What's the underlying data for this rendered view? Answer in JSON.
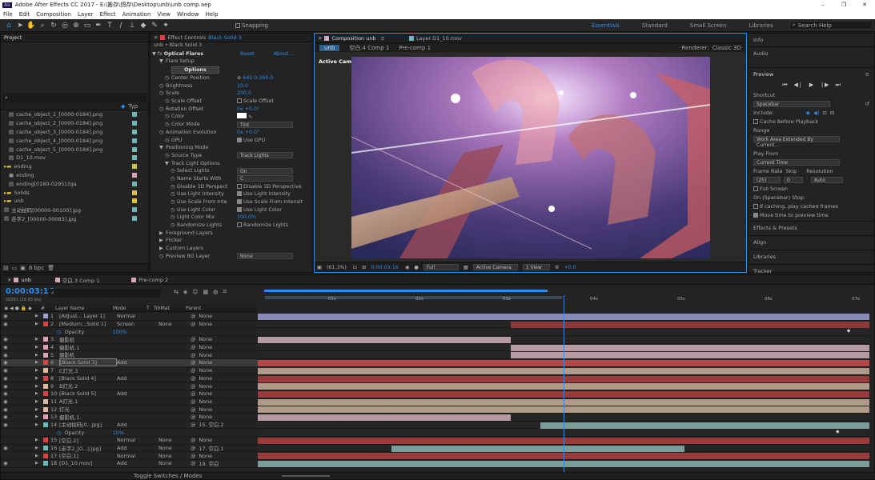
{
  "window": {
    "app_icon": "Ae",
    "title": "Adobe After Effects CC 2017 - E:\\搬存\\鸽存\\Desktop\\unb\\unb comp.aep",
    "controls": [
      "–",
      "❐",
      "✕"
    ]
  },
  "menu": [
    "File",
    "Edit",
    "Composition",
    "Layer",
    "Effect",
    "Animation",
    "View",
    "Window",
    "Help"
  ],
  "toolbar": {
    "snapping": "Snapping",
    "workspaces": [
      "Essentials",
      "Standard",
      "Small Screen",
      "Libraries"
    ],
    "search_placeholder": "Search Help"
  },
  "project": {
    "tab": "Project",
    "footer": "8 bpc",
    "col_type": "Typ",
    "items": [
      {
        "label": "cache_object_1_[0000-0184].png",
        "indent": 1,
        "kind": "file",
        "color": "#6fb8b8"
      },
      {
        "label": "cache_object_2_[0000-0184].png",
        "indent": 1,
        "kind": "file",
        "color": "#6fb8b8"
      },
      {
        "label": "cache_object_3_[0000-0184].png",
        "indent": 1,
        "kind": "file",
        "color": "#6fb8b8"
      },
      {
        "label": "cache_object_4_[0000-0184].png",
        "indent": 1,
        "kind": "file",
        "color": "#6fb8b8"
      },
      {
        "label": "cache_object_5_[0000-0184].png",
        "indent": 1,
        "kind": "file",
        "color": "#6fb8b8"
      },
      {
        "label": "D1_10.mov",
        "indent": 1,
        "kind": "file",
        "color": "#6fb8b8"
      },
      {
        "label": "ending",
        "indent": 0,
        "kind": "folder",
        "color": "#d8c040"
      },
      {
        "label": "ending",
        "indent": 1,
        "kind": "comp",
        "color": "#d8a8b8"
      },
      {
        "label": "ending[0180-0295].tga",
        "indent": 1,
        "kind": "file",
        "color": "#6fb8b8"
      },
      {
        "label": "Solids",
        "indent": 0,
        "kind": "folder",
        "color": "#d8c040"
      },
      {
        "label": "unb",
        "indent": 0,
        "kind": "folder",
        "color": "#d8c040"
      },
      {
        "label": "主动拍码[00000-00100].jpg",
        "indent": 0,
        "kind": "file",
        "color": "#6fb8b8"
      },
      {
        "label": "走字2_[00000-00083].jpg",
        "indent": 0,
        "kind": "file",
        "color": "#6fb8b8"
      }
    ]
  },
  "effect_controls": {
    "tab_prefix": "Effect Controls",
    "tab_layer": "Black Solid 3",
    "breadcrumb": "unb • Black Solid 3",
    "effect_name": "Optical Flares",
    "reset": "Reset",
    "about": "About...",
    "options_button": "Options",
    "props": [
      {
        "l": "Flare Setup",
        "t": "group",
        "i": 1
      },
      {
        "l": "Center Position",
        "v": "640.0,360.0",
        "t": "pos",
        "i": 2
      },
      {
        "l": "Brightness",
        "v": "10.0",
        "t": "val",
        "i": 1
      },
      {
        "l": "Scale",
        "v": "200.0",
        "t": "val",
        "i": 1
      },
      {
        "l": "Scale Offset",
        "c": "Scale Offset",
        "t": "cb",
        "i": 2
      },
      {
        "l": "Rotation Offset",
        "v": "0x +0.0°",
        "t": "val",
        "i": 1
      },
      {
        "l": "Color",
        "t": "color",
        "i": 2
      },
      {
        "l": "Color Mode",
        "s": "Tint",
        "t": "sel",
        "i": 2
      },
      {
        "l": "Animation Evolution",
        "v": "0x +0.0°",
        "t": "val",
        "i": 1
      },
      {
        "l": "GPU",
        "c": "Use GPU",
        "t": "cb",
        "i": 2,
        "on": true
      },
      {
        "l": "Positioning Mode",
        "t": "group",
        "i": 1
      },
      {
        "l": "Source Type",
        "s": "Track Lights",
        "t": "sel",
        "i": 2
      },
      {
        "l": "Track Light Options",
        "t": "group",
        "i": 2
      },
      {
        "l": "Select Lights",
        "s": "On",
        "t": "sel",
        "i": 3
      },
      {
        "l": "Name Starts With",
        "s": "C",
        "t": "sel",
        "i": 3
      },
      {
        "l": "Disable 3D Perspect",
        "c": "Disable 3D Perspective",
        "t": "cb",
        "i": 3
      },
      {
        "l": "Use Light Intensity",
        "c": "Use Light Intensity",
        "t": "cb",
        "i": 3,
        "on": true
      },
      {
        "l": "Use Scale From Inte",
        "c": "Use Scale From Intensit",
        "t": "cb",
        "i": 3,
        "on": true
      },
      {
        "l": "Use Light Color",
        "c": "Use Light Color",
        "t": "cb",
        "i": 3,
        "on": true
      },
      {
        "l": "Light Color Mix",
        "v": "100.0%",
        "t": "val",
        "i": 3
      },
      {
        "l": "Randomize Lights",
        "c": "Randomize Lights",
        "t": "cb",
        "i": 3
      },
      {
        "l": "Foreground Layers",
        "t": "group",
        "i": 1
      },
      {
        "l": "Flicker",
        "t": "group",
        "i": 1
      },
      {
        "l": "Custom Layers",
        "t": "group",
        "i": 1
      },
      {
        "l": "Preview BG Layer",
        "s": "None",
        "t": "sel",
        "i": 1
      }
    ]
  },
  "viewer": {
    "tab_comp": "Composition unb",
    "tab_layer": "Layer D1_10.mov",
    "flow": [
      "unb",
      "空白.4 Comp 1",
      "Pre-comp 1"
    ],
    "renderer_label": "Renderer:",
    "renderer": "Classic 3D",
    "active_camera": "Active Camera",
    "footer": {
      "zoom": "(61.3%)",
      "time": "0:00:03:16",
      "resolution": "Full",
      "camera": "Active Camera",
      "views": "1 View",
      "exposure": "+0.0"
    }
  },
  "right": {
    "info": "Info",
    "audio": "Audio",
    "preview": "Preview",
    "shortcut_label": "Shortcut",
    "shortcut": "Spacebar",
    "include": "Include:",
    "cache_before": "Cache Before Playback",
    "range_label": "Range",
    "range": "Work Area Extended By Current...",
    "play_from_label": "Play From",
    "play_from": "Current Time",
    "frame_rate_label": "Frame Rate",
    "skip_label": "Skip",
    "resolution_label": "Resolution",
    "frame_rate": "(25)",
    "skip": "0",
    "resolution": "Auto",
    "full_screen": "Full Screen",
    "stop_label": "On (Spacebar) Stop:",
    "if_caching": "If caching, play cached frames",
    "move_time": "Move time to preview time",
    "sections": [
      "Effects & Presets",
      "Align",
      "Libraries",
      "Tracker"
    ]
  },
  "timeline": {
    "tabs": [
      "unb",
      "空白.3 Comp 1",
      "Pre-comp 2"
    ],
    "timecode": "0:00:03:16",
    "frames": "00091 (25.00 fps)",
    "cols": [
      "#",
      "Layer Name",
      "Mode",
      "T",
      "TrkMat",
      "Parent"
    ],
    "ruler": [
      "01s",
      "02s",
      "03s",
      "04s",
      "05s",
      "06s",
      "07s"
    ],
    "playhead": 0.4999,
    "work_start": 0.012,
    "work_end": 0.497,
    "footer": "Toggle Switches / Modes",
    "rows": [
      {
        "n": "1",
        "name": "[Adjust... Layer 1]",
        "mode": "Normal",
        "trk": "",
        "par": "None",
        "color": "#a0a0d0",
        "bar": [
          0,
          1
        ],
        "bc": "#8a8ab8",
        "eye": true
      },
      {
        "n": "2",
        "name": "[Medium...Solid 1]",
        "mode": "Screen",
        "trk": "None",
        "par": "None",
        "color": "#e04040",
        "bar": [
          0.413,
          1
        ],
        "bc": "#8a3a3a",
        "eye": true
      },
      {
        "sub": "Opacity",
        "val": "100%",
        "key": 0.963
      },
      {
        "n": "3",
        "name": "摄影机",
        "mode": "",
        "trk": "",
        "par": "None",
        "color": "#e0a0b0",
        "bar": [
          0,
          0.413
        ],
        "bc": "#b59aa2",
        "eye": true
      },
      {
        "n": "4",
        "name": "摄影机.1",
        "mode": "",
        "trk": "",
        "par": "None",
        "color": "#e0a0b0",
        "bar": [
          0.413,
          1
        ],
        "bc": "#b59aa2",
        "eye": true
      },
      {
        "n": "5",
        "name": "摄影机",
        "mode": "",
        "trk": "",
        "par": "None",
        "color": "#e0a0b0",
        "bar": [
          0.413,
          1
        ],
        "bc": "#b59aa2",
        "eye": true
      },
      {
        "n": "6",
        "name": "[Black Solid 3]",
        "mode": "Add",
        "trk": "",
        "par": "None",
        "color": "#e04040",
        "bar": [
          0,
          1
        ],
        "bc": "#b04848",
        "eye": true,
        "sel": true
      },
      {
        "n": "7",
        "name": "C灯光.3",
        "mode": "",
        "trk": "",
        "par": "None",
        "color": "#e0b8a0",
        "bar": [
          0,
          1
        ],
        "bc": "#b09a88",
        "eye": true
      },
      {
        "n": "8",
        "name": "[Black Solid 4]",
        "mode": "Add",
        "trk": "",
        "par": "None",
        "color": "#e04040",
        "bar": [
          0,
          1
        ],
        "bc": "#9a3a3a",
        "eye": true
      },
      {
        "n": "9",
        "name": "B灯光.2",
        "mode": "",
        "trk": "",
        "par": "None",
        "color": "#e0b8a0",
        "bar": [
          0,
          1
        ],
        "bc": "#b09a88",
        "eye": true
      },
      {
        "n": "10",
        "name": "[Black Solid 5]",
        "mode": "Add",
        "trk": "",
        "par": "None",
        "color": "#e04040",
        "bar": [
          0,
          1
        ],
        "bc": "#9a3a3a",
        "eye": true
      },
      {
        "n": "11",
        "name": "A灯光.1",
        "mode": "",
        "trk": "",
        "par": "None",
        "color": "#e0b8a0",
        "bar": [
          0,
          1
        ],
        "bc": "#b09a88",
        "eye": true
      },
      {
        "n": "12",
        "name": "灯光",
        "mode": "",
        "trk": "",
        "par": "None",
        "color": "#e0b8a0",
        "bar": [
          0,
          1
        ],
        "bc": "#b09a88",
        "eye": true
      },
      {
        "n": "13",
        "name": "摄影机.1",
        "mode": "",
        "trk": "",
        "par": "None",
        "color": "#e0a0b0",
        "bar": [
          0,
          0.413
        ],
        "bc": "#b59aa2",
        "eye": true
      },
      {
        "n": "14",
        "name": "[主动拍码[0...jpg]",
        "mode": "Add",
        "trk": "",
        "par": "15. 空白.2",
        "color": "#6fb8b8",
        "bar": [
          0.462,
          1
        ],
        "bc": "#7a9c9c",
        "eye": true
      },
      {
        "sub": "Opacity",
        "val": "10%",
        "key": 0.945
      },
      {
        "n": "15",
        "name": "[空白.2]",
        "mode": "Normal",
        "trk": "None",
        "par": "None",
        "color": "#e04040",
        "bar": [
          0,
          1
        ],
        "bc": "#9a3a3a",
        "eye": false
      },
      {
        "n": "16",
        "name": "[走字2_[0...].jpg]",
        "mode": "Add",
        "trk": "None",
        "par": "17. 空白.1",
        "color": "#6fb8b8",
        "bar": [
          0.218,
          0.697
        ],
        "bc": "#7a9c9c",
        "eye": true
      },
      {
        "n": "17",
        "name": "[空白.1]",
        "mode": "Normal",
        "trk": "None",
        "par": "None",
        "color": "#e04040",
        "bar": [
          0,
          1
        ],
        "bc": "#9a3a3a",
        "eye": false
      },
      {
        "n": "18",
        "name": "[D1_10.mov]",
        "mode": "Add",
        "trk": "None",
        "par": "19. 空白",
        "color": "#6fb8b8",
        "bar": [
          0,
          1
        ],
        "bc": "#7a9c9c",
        "eye": true
      }
    ]
  }
}
